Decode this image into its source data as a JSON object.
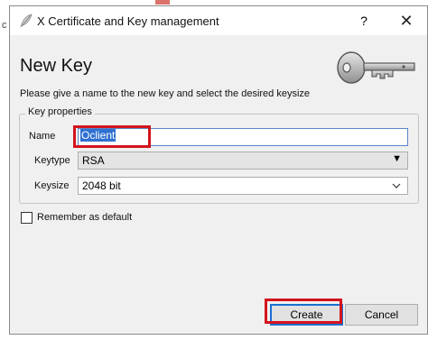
{
  "window": {
    "title": "X Certificate and Key management",
    "help_label": "?",
    "close_label": "✕"
  },
  "dialog": {
    "heading": "New Key",
    "description": "Please give a name to the new key and select the desired keysize"
  },
  "key_properties": {
    "group_title": "Key properties",
    "name_label": "Name",
    "name_value": "Oclient",
    "keytype_label": "Keytype",
    "keytype_value": "RSA",
    "keysize_label": "Keysize",
    "keysize_value": "2048 bit"
  },
  "remember_default": {
    "label": "Remember as default",
    "checked": false
  },
  "buttons": {
    "create_label": "Create",
    "cancel_label": "Cancel"
  },
  "highlight_color": "#d3141c",
  "background_fragment_text": "c",
  "icons": [
    "feather-icon",
    "key-icon",
    "chevron-down-icon"
  ]
}
